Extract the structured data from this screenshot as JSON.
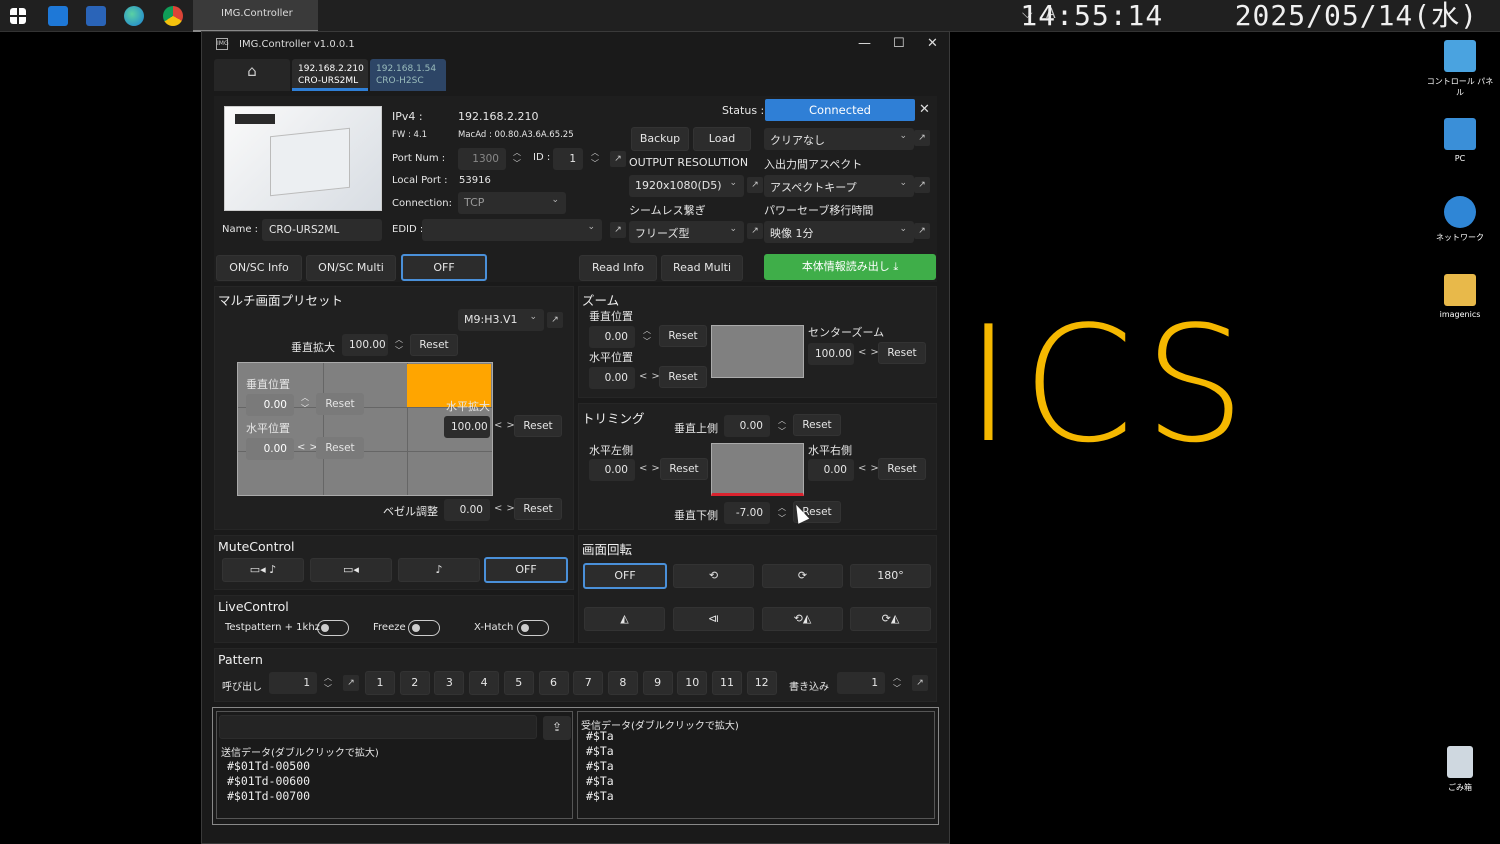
{
  "taskbar": {
    "app_label": "IMG.Controller",
    "tray_ime": "A",
    "time": "14:55:14",
    "date": "2025/05/14(水)"
  },
  "desktop": {
    "icons": [
      "コントロール パネル",
      "PC",
      "ネットワーク",
      "imagenics",
      "ごみ箱"
    ],
    "wallpaper_text": "ICS"
  },
  "window": {
    "title": "IMG.Controller v1.0.0.1"
  },
  "tabs": [
    {
      "ip": "192.168.2.210",
      "model": "CRO-URS2ML"
    },
    {
      "ip": "192.168.1.54",
      "model": "CRO-H2SC"
    }
  ],
  "device": {
    "ipv4_label": "IPv4 :",
    "ipv4": "192.168.2.210",
    "fw": "FW : 4.1",
    "mac": "MacAd : 00.80.A3.6A.65.25",
    "port_label": "Port Num :",
    "port": "1300",
    "id_label": "ID :",
    "id": "1",
    "local_port_label": "Local Port :",
    "local_port": "53916",
    "connection_label": "Connection:",
    "connection": "TCP",
    "name_label": "Name :",
    "name": "CRO-URS2ML",
    "edid_label": "EDID :",
    "status_label": "Status :",
    "status": "Connected",
    "backup": "Backup",
    "load": "Load",
    "clear": "クリアなし",
    "output_res_label": "OUTPUT RESOLUTION",
    "output_res": "1920x1080(D5)",
    "aspect_label": "入出力間アスペクト",
    "aspect": "アスペクトキープ",
    "seamless_label": "シームレス繋ぎ",
    "seamless": "フリーズ型",
    "powersave_label": "パワーセーブ移行時間",
    "powersave": "映像 1分"
  },
  "info_buttons": {
    "onsc_info": "ON/SC Info",
    "onsc_multi": "ON/SC Multi",
    "off": "OFF",
    "read_info": "Read Info",
    "read_multi": "Read Multi",
    "read_body": "本体情報読み出し"
  },
  "multi": {
    "title": "マルチ画面プリセット",
    "preset": "M9:H3.V1",
    "v_zoom_label": "垂直拡大",
    "v_zoom": "100.00",
    "v_pos_label": "垂直位置",
    "v_pos": "0.00",
    "h_pos_label": "水平位置",
    "h_pos": "0.00",
    "h_zoom_label": "水平拡大",
    "h_zoom": "100.00",
    "bezel_label": "ベゼル調整",
    "bezel": "0.00",
    "reset": "Reset"
  },
  "zoom": {
    "title": "ズーム",
    "v_pos_label": "垂直位置",
    "v_pos": "0.00",
    "h_pos_label": "水平位置",
    "h_pos": "0.00",
    "center_label": "センターズーム",
    "center": "100.00"
  },
  "trim": {
    "title": "トリミング",
    "top_label": "垂直上側",
    "top": "0.00",
    "left_label": "水平左側",
    "left": "0.00",
    "right_label": "水平右側",
    "right": "0.00",
    "bottom_label": "垂直下側",
    "bottom": "-7.00"
  },
  "mute": {
    "title": "MuteControl",
    "off": "OFF"
  },
  "rotate": {
    "title": "画面回転",
    "off": "OFF",
    "r180": "180°"
  },
  "live": {
    "title": "LiveControl",
    "testpattern": "Testpattern + 1khz",
    "freeze": "Freeze",
    "xhatch": "X-Hatch"
  },
  "pattern": {
    "title": "Pattern",
    "recall_label": "呼び出し",
    "recall": "1",
    "numbers": [
      "1",
      "2",
      "3",
      "4",
      "5",
      "6",
      "7",
      "8",
      "9",
      "10",
      "11",
      "12"
    ],
    "write_label": "書き込み",
    "write": "1"
  },
  "log": {
    "send_label": "送信データ(ダブルクリックで拡大)",
    "send_lines": [
      "#$01Td-00500",
      "#$01Td-00600",
      "#$01Td-00700"
    ],
    "recv_label": "受信データ(ダブルクリックで拡大)",
    "recv_lines": [
      "#$Ta",
      "#$Ta",
      "#$Ta",
      "#$Ta",
      "#$Ta"
    ]
  },
  "colors": {
    "accent": "#2f7fd6",
    "green": "#3fae49",
    "orange": "#ffa500",
    "trim_red": "#d9232e"
  }
}
